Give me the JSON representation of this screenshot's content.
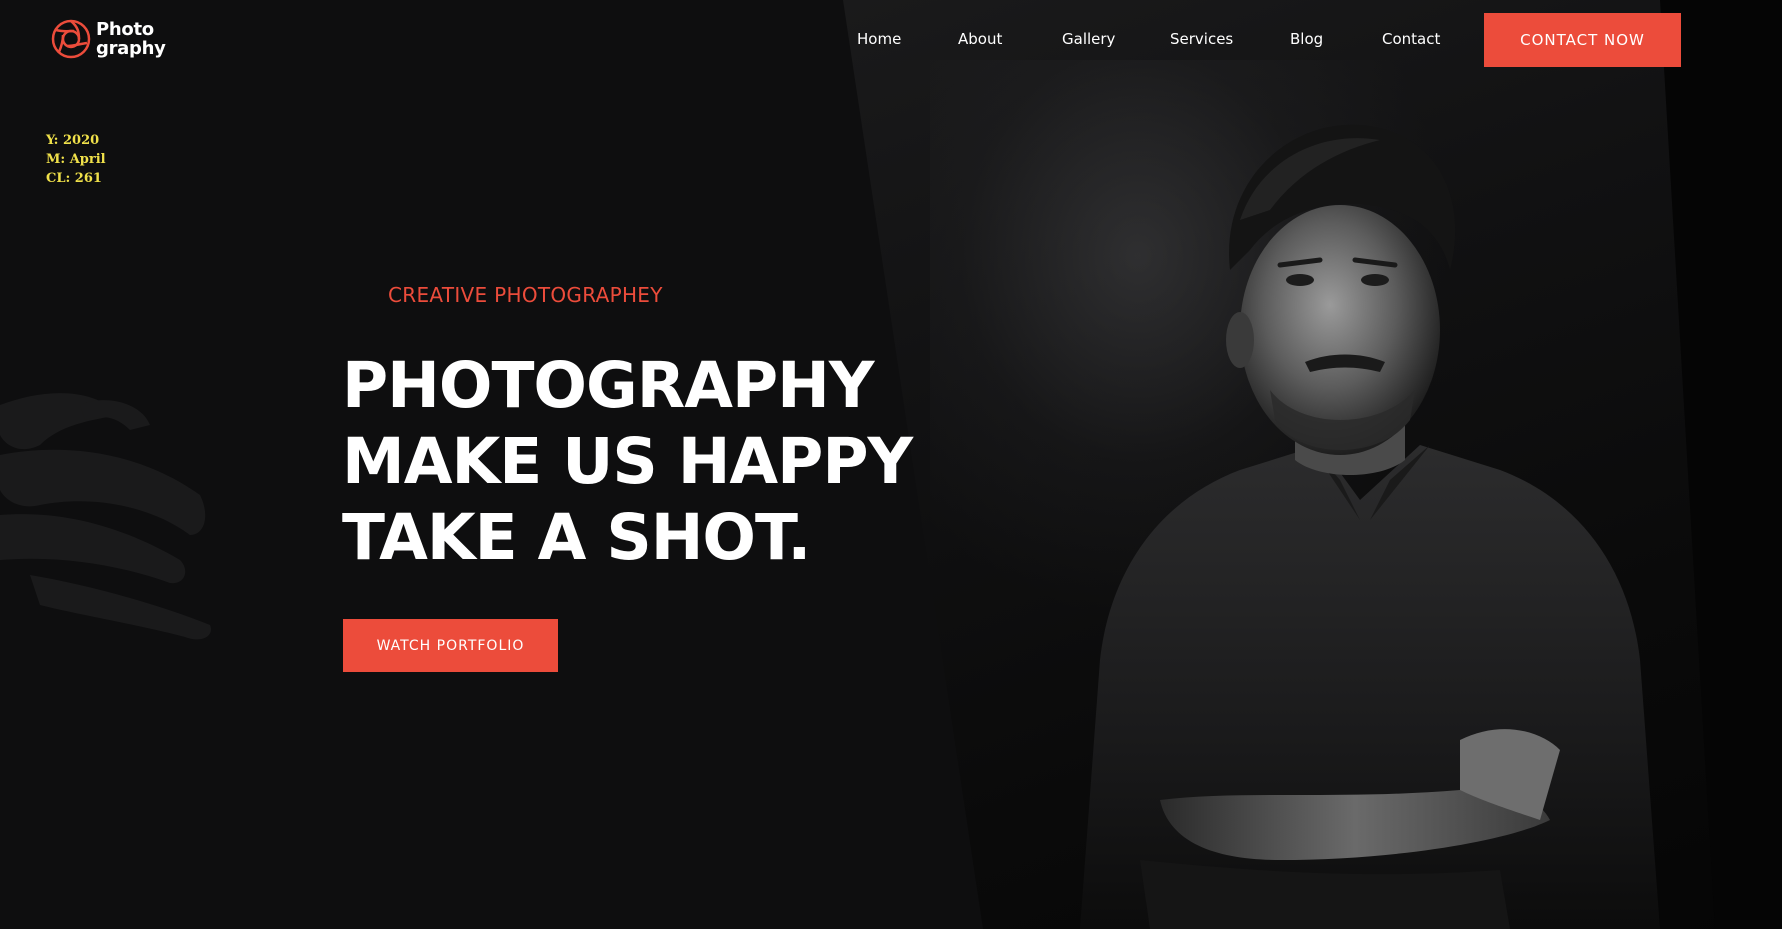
{
  "brand": {
    "line1": "Photo",
    "line2": "graphy",
    "accent_color": "#ec4c3b"
  },
  "nav": {
    "items": [
      {
        "label": "Home"
      },
      {
        "label": "About"
      },
      {
        "label": "Gallery"
      },
      {
        "label": "Services"
      },
      {
        "label": "Blog"
      },
      {
        "label": "Contact"
      }
    ],
    "cta_label": "CONTACT NOW"
  },
  "overlay": {
    "year": "Y: 2020",
    "month": "M: April",
    "cl": "CL: 261"
  },
  "hero": {
    "eyebrow": "CREATIVE PHOTOGRAPHEY",
    "headline": [
      "PHOTOGRAPHY",
      "MAKE US HAPPY",
      "TAKE A SHOT."
    ],
    "button_label": "WATCH PORTFOLIO"
  },
  "icons": {
    "logo": "camera-aperture-icon",
    "brush": "brush-stroke-decoration",
    "portrait": "portrait-photo"
  },
  "colors": {
    "background": "#0e0e0f",
    "accent": "#ec4c3b",
    "overlay_text": "#f0e14a"
  }
}
